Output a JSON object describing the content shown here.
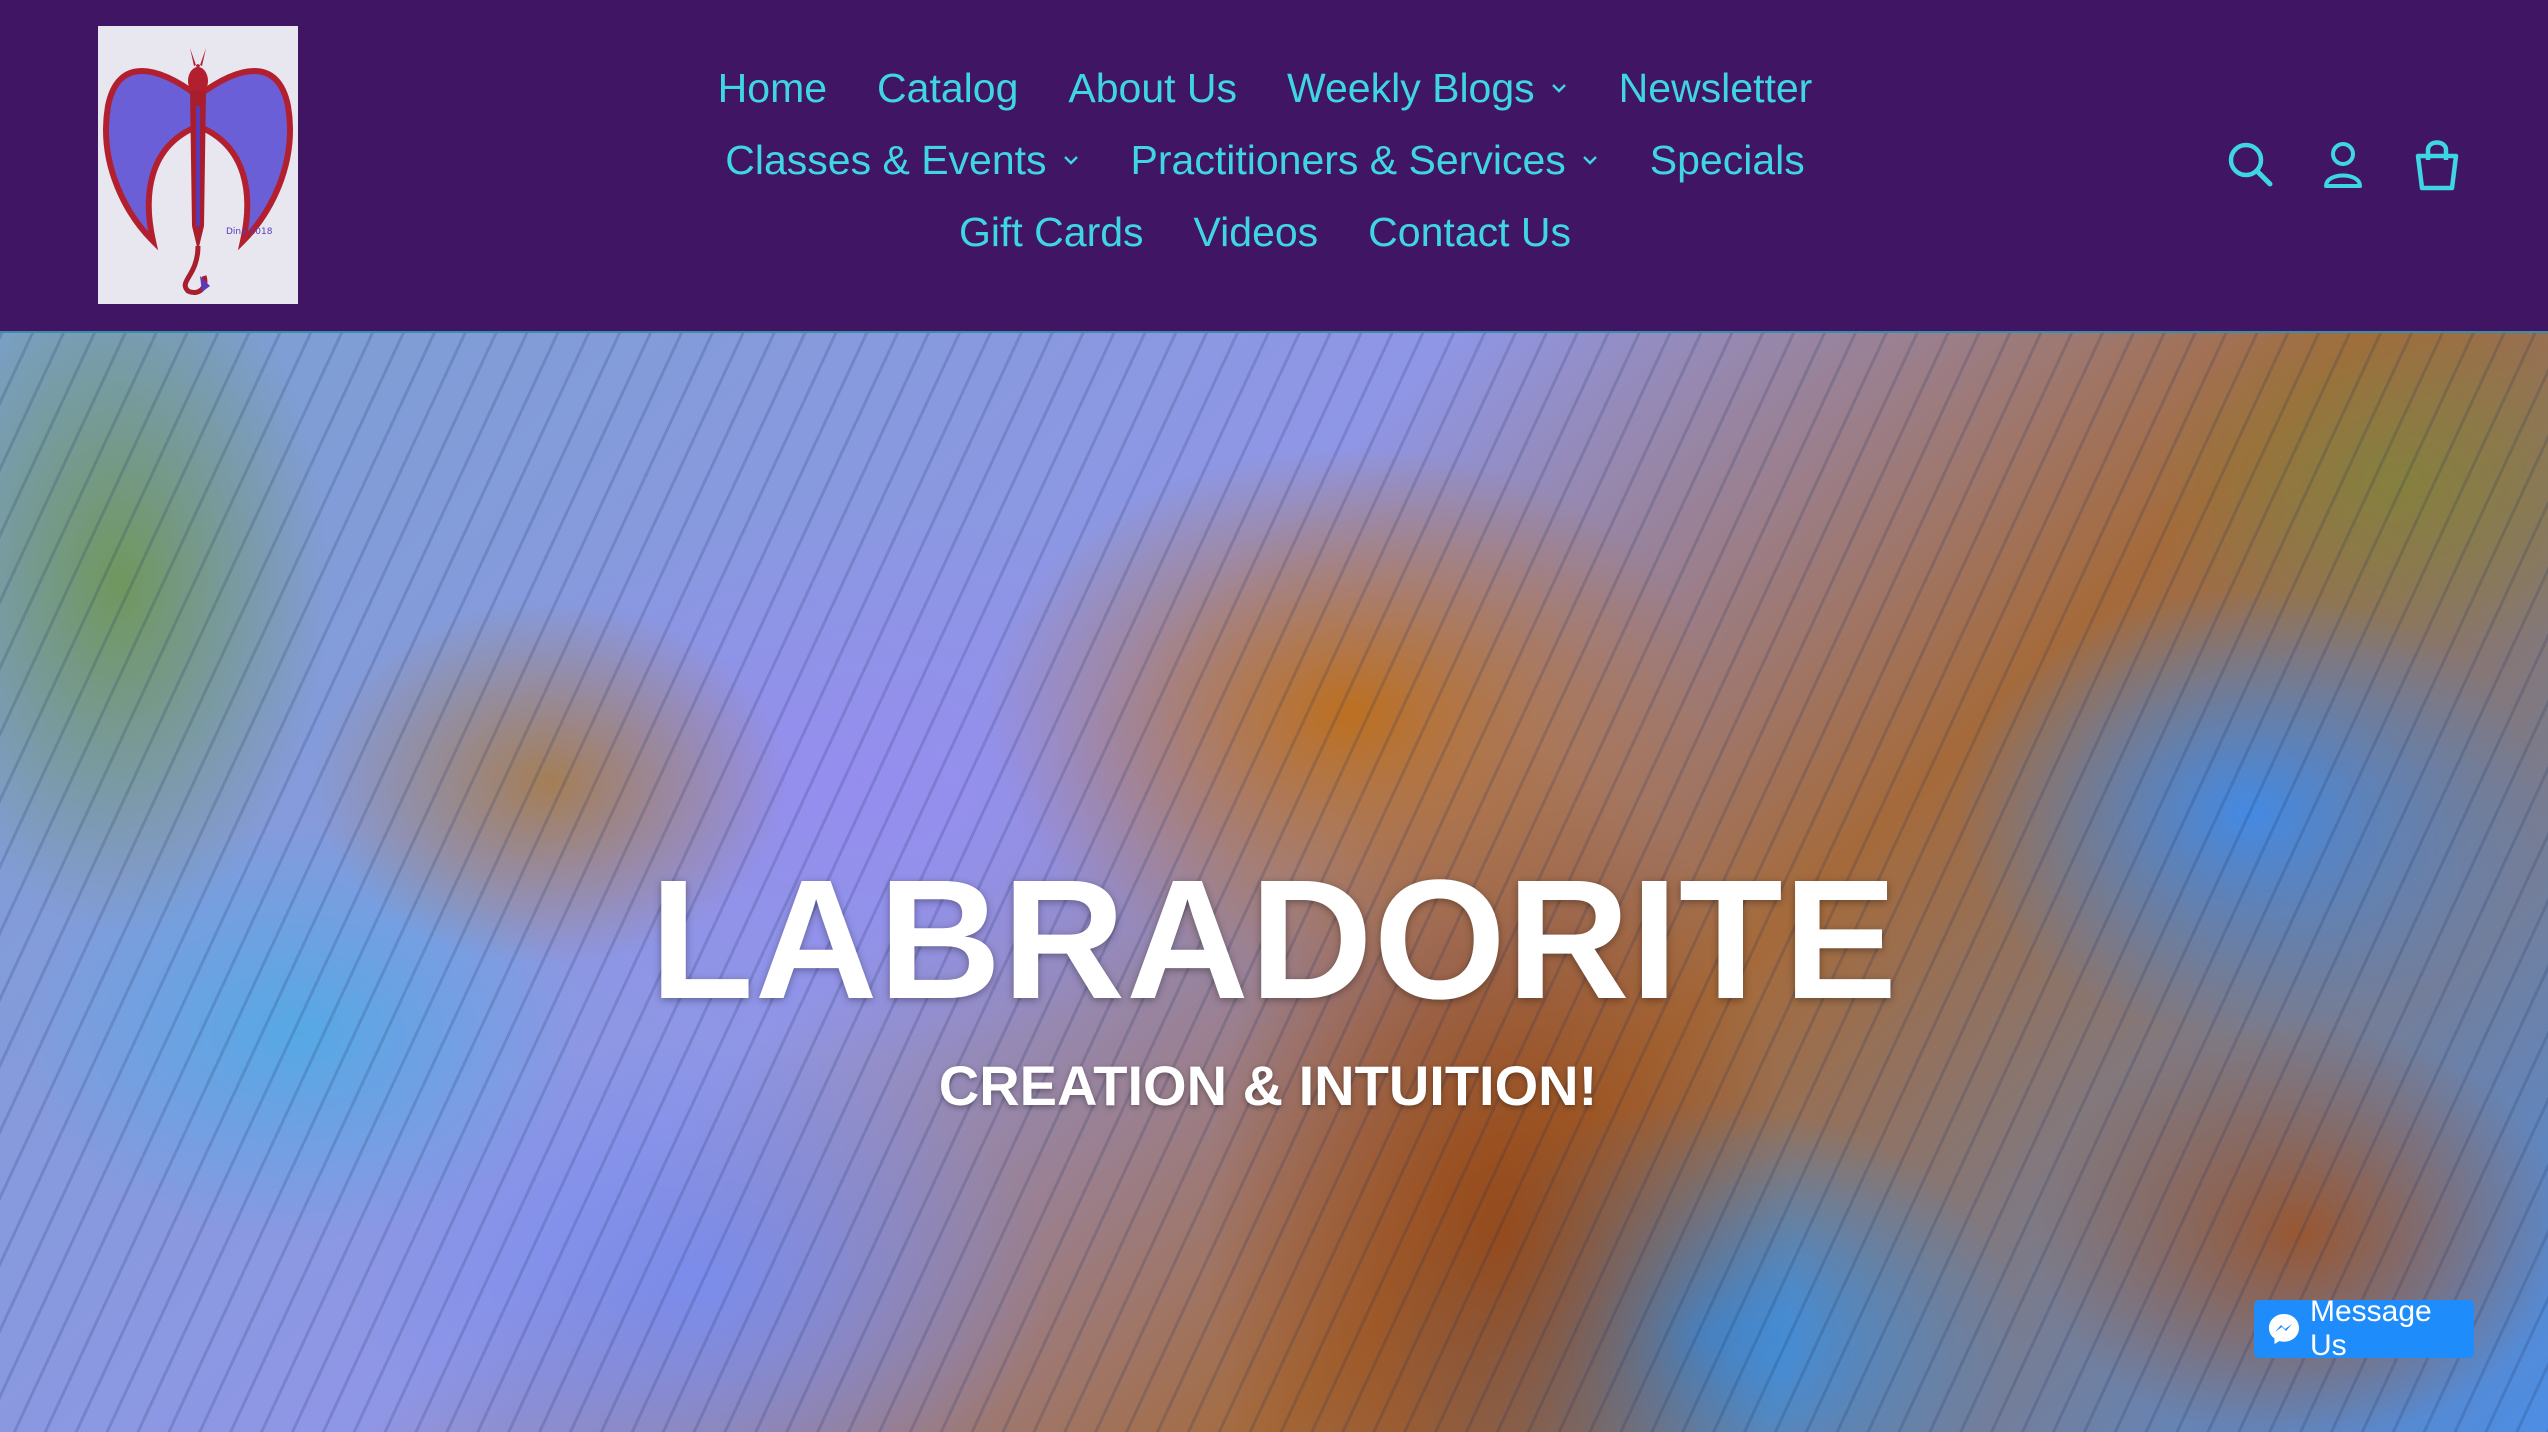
{
  "colors": {
    "header_bg": "#401564",
    "nav_text": "#3fd6e3",
    "hero_text": "#ffffff",
    "messenger_blue": "#1e8dfb"
  },
  "logo": {
    "icon": "dragon-logo-icon",
    "signature": "Dina 2018"
  },
  "nav": {
    "row1": [
      {
        "label": "Home"
      },
      {
        "label": "Catalog"
      },
      {
        "label": "About Us"
      },
      {
        "label": "Weekly Blogs",
        "dropdown": true
      },
      {
        "label": "Newsletter"
      }
    ],
    "row2": [
      {
        "label": "Classes & Events",
        "dropdown": true
      },
      {
        "label": "Practitioners & Services",
        "dropdown": true
      },
      {
        "label": "Specials"
      }
    ],
    "row3": [
      {
        "label": "Gift Cards"
      },
      {
        "label": "Videos"
      },
      {
        "label": "Contact Us"
      }
    ]
  },
  "header_icons": [
    "search-icon",
    "account-icon",
    "cart-icon"
  ],
  "hero": {
    "title": "LABRADORITE",
    "subtitle": "CREATION & INTUITION!"
  },
  "messenger": {
    "label": "Message Us",
    "icon": "messenger-icon"
  }
}
